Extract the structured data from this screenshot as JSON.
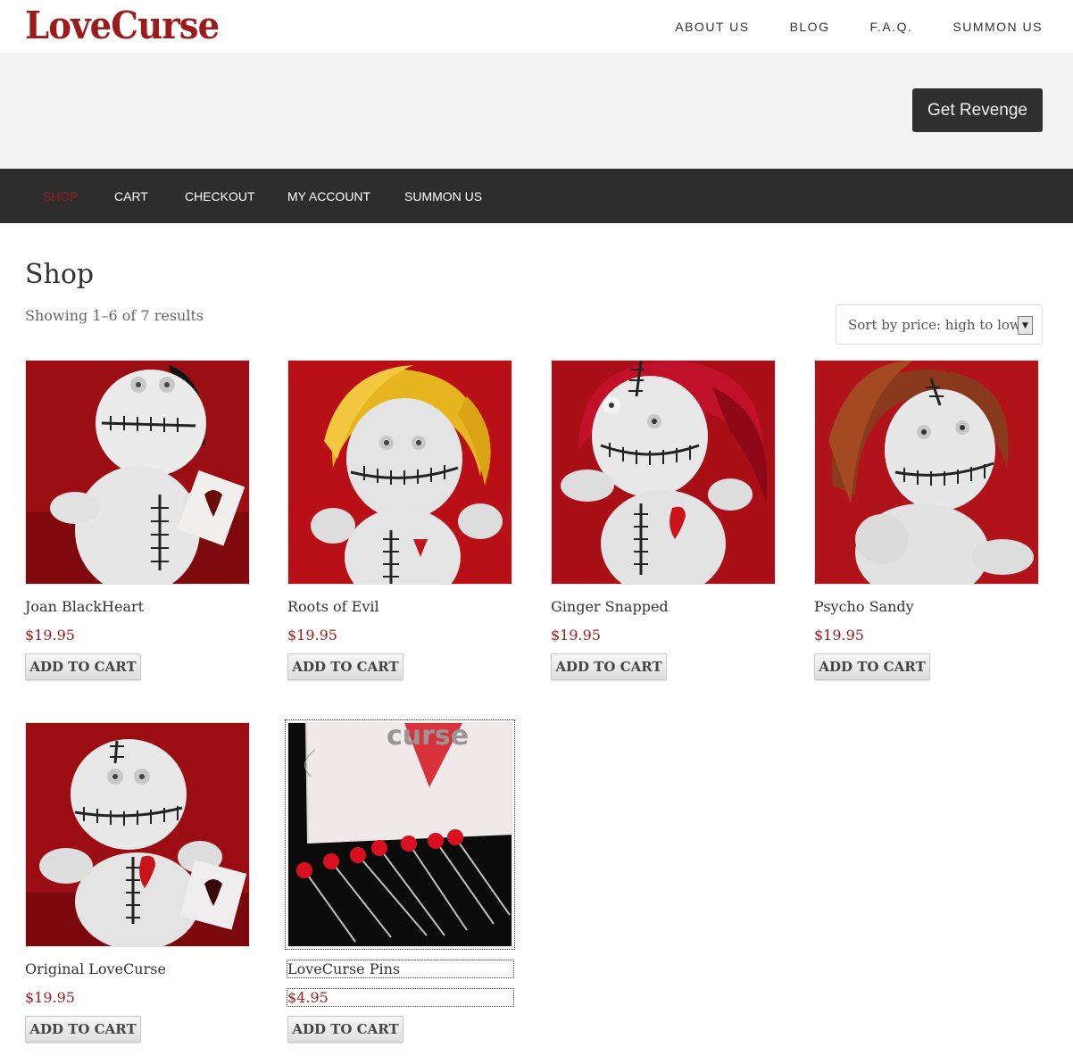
{
  "site": {
    "logo": "LoveCurse"
  },
  "top_nav": [
    "ABOUT US",
    "BLOG",
    "F.A.Q.",
    "SUMMON US"
  ],
  "hero": {
    "button_label": "Get Revenge"
  },
  "main_nav": [
    {
      "label": "SHOP",
      "active": true
    },
    {
      "label": "CART",
      "active": false
    },
    {
      "label": "CHECKOUT",
      "active": false
    },
    {
      "label": "MY ACCOUNT",
      "active": false
    },
    {
      "label": "SUMMON US",
      "active": false
    }
  ],
  "shop": {
    "title": "Shop",
    "results_text": "Showing 1–6 of 7 results",
    "sort_selected": "Sort by price: high to low",
    "add_to_cart_label": "ADD TO CART",
    "products": [
      {
        "name": "Joan BlackHeart",
        "price": "$19.95",
        "hair": "black"
      },
      {
        "name": "Roots of Evil",
        "price": "$19.95",
        "hair": "yellow"
      },
      {
        "name": "Ginger Snapped",
        "price": "$19.95",
        "hair": "red"
      },
      {
        "name": "Psycho Sandy",
        "price": "$19.95",
        "hair": "brown"
      },
      {
        "name": "Original LoveCurse",
        "price": "$19.95",
        "hair": "none"
      },
      {
        "name": "LoveCurse Pins",
        "price": "$4.95",
        "hair": "pins"
      }
    ]
  },
  "colors": {
    "brand_red": "#9e1b1b",
    "nav_dark": "#2d2d2d",
    "hero_bg": "#f4f4f4"
  }
}
